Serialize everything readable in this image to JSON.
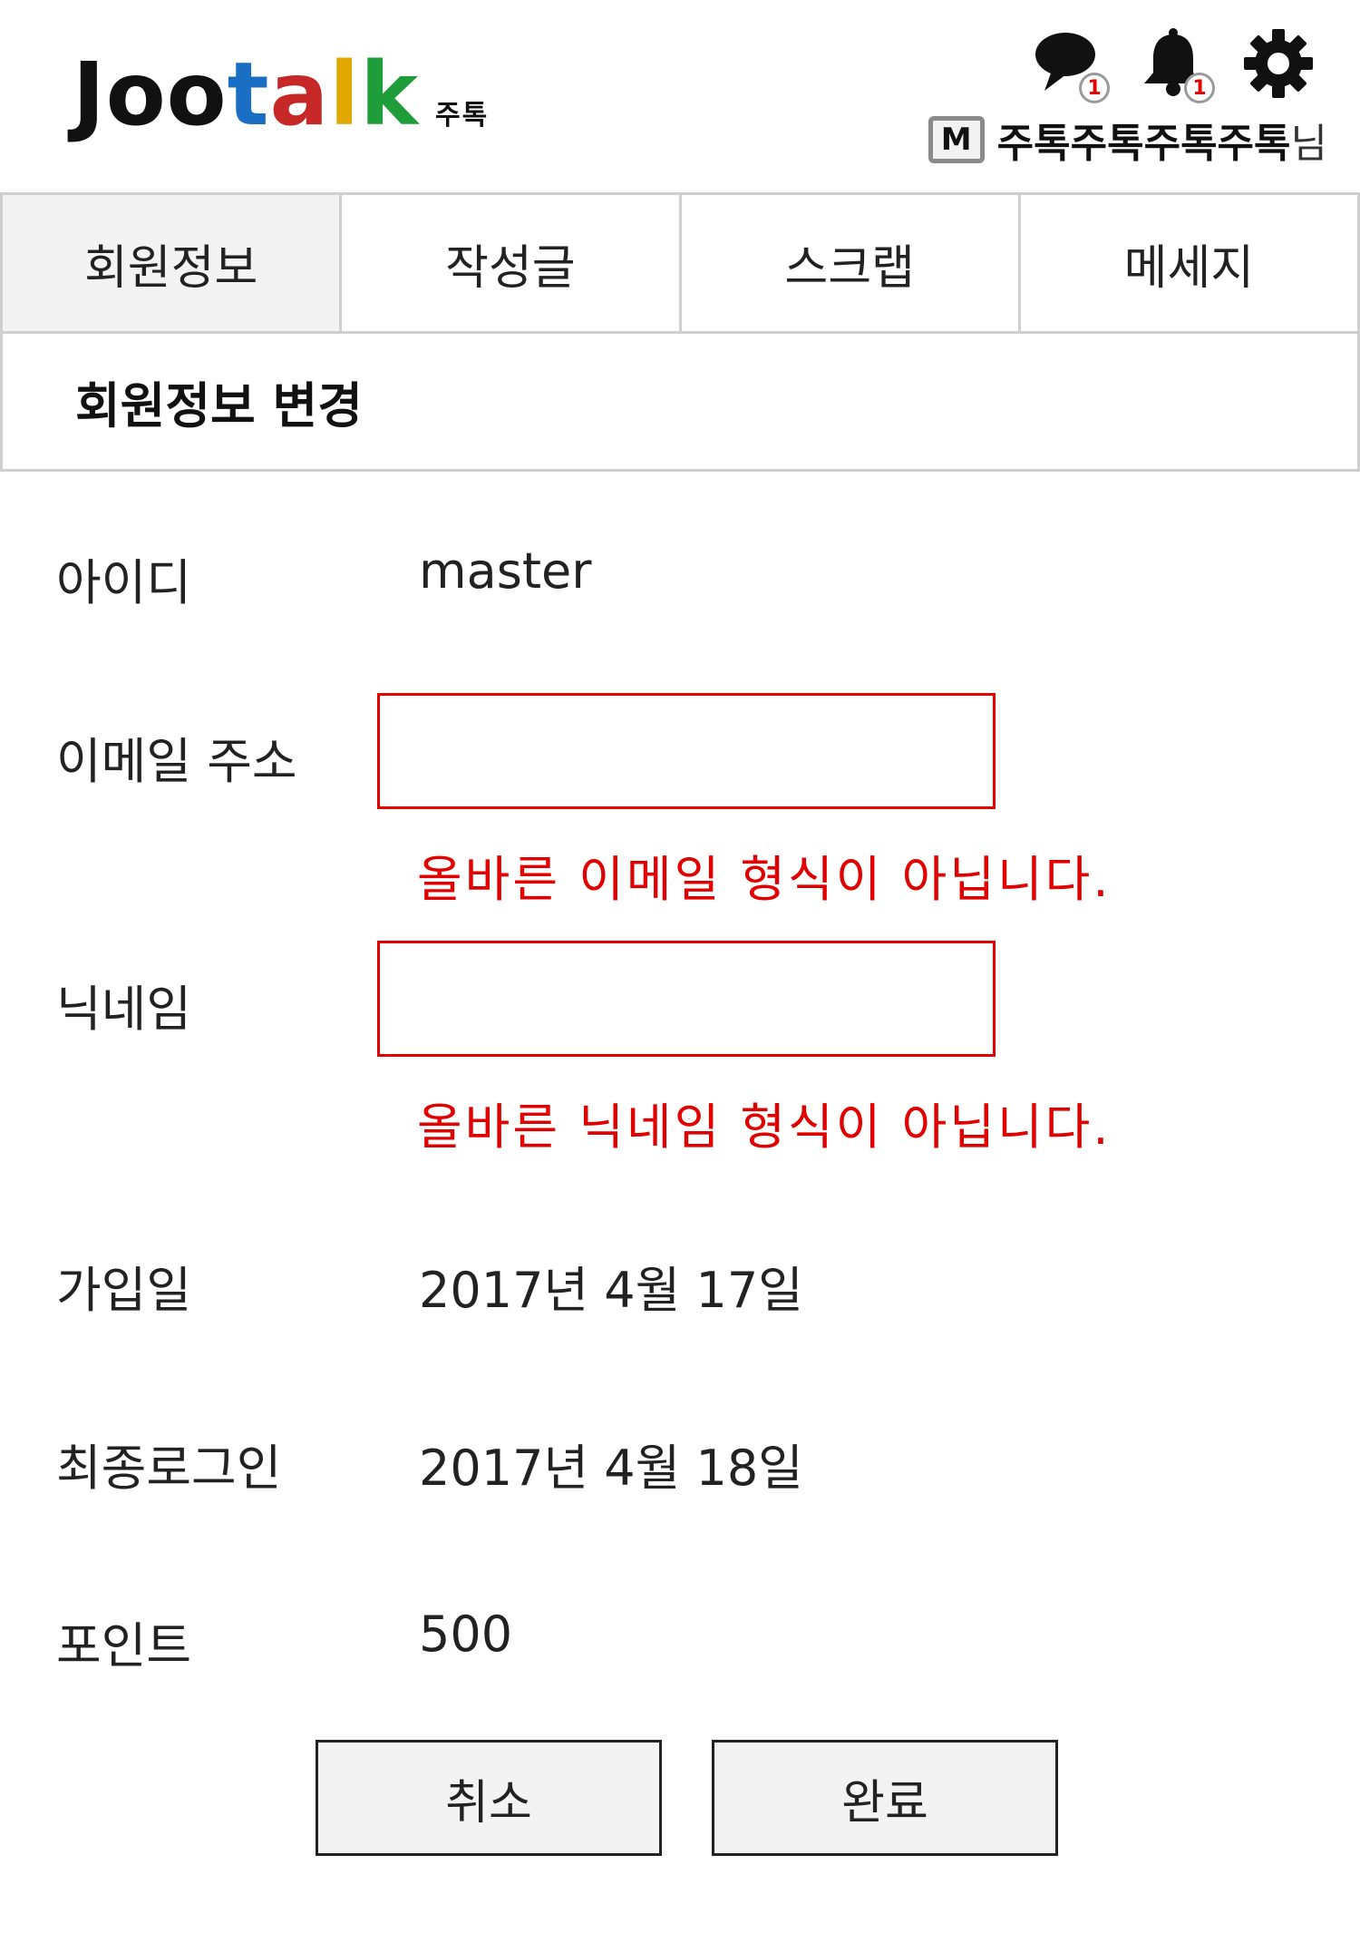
{
  "header": {
    "logo": {
      "letters": [
        {
          "char": "J",
          "color": "#111111"
        },
        {
          "char": "o",
          "color": "#111111"
        },
        {
          "char": "o",
          "color": "#111111"
        },
        {
          "char": "t",
          "color": "#1a6fc4"
        },
        {
          "char": "a",
          "color": "#c62828"
        },
        {
          "char": "l",
          "color": "#e0a800"
        },
        {
          "char": "k",
          "color": "#1f9d3a"
        }
      ],
      "subtitle": "주톡"
    },
    "icons": [
      {
        "name": "chat-icon",
        "badge": "1"
      },
      {
        "name": "bell-icon",
        "badge": "1"
      },
      {
        "name": "gear-icon"
      }
    ],
    "user": {
      "grade_letter": "M",
      "name": "주톡주톡주톡주톡",
      "suffix": "님"
    }
  },
  "tabs": [
    {
      "label": "회원정보",
      "active": true
    },
    {
      "label": "작성글",
      "active": false
    },
    {
      "label": "스크랩",
      "active": false
    },
    {
      "label": "메세지",
      "active": false
    }
  ],
  "section_title": "회원정보 변경",
  "form": {
    "id_label": "아이디",
    "id_value": "master",
    "email_label": "이메일 주소",
    "email_value": "",
    "email_error": "올바른 이메일 형식이 아닙니다.",
    "nickname_label": "닉네임",
    "nickname_value": "",
    "nickname_error": "올바른 닉네임 형식이 아닙니다.",
    "joined_label": "가입일",
    "joined_value": "2017년 4월 17일",
    "last_login_label": "최종로그인",
    "last_login_value": "2017년 4월 18일",
    "points_label": "포인트",
    "points_value": "500"
  },
  "buttons": {
    "cancel": "취소",
    "confirm": "완료"
  },
  "colors": {
    "error": "#e00000",
    "border": "#cfcfcf",
    "active_tab_bg": "#f3f3f3"
  }
}
